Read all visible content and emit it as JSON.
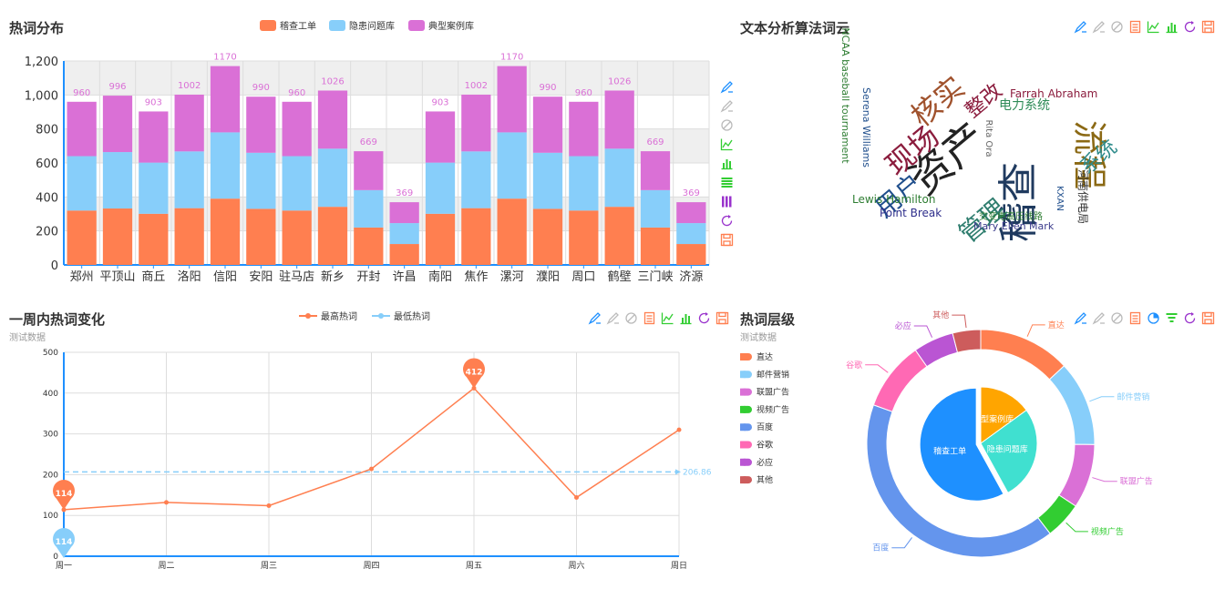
{
  "hot_distribution": {
    "title": "热词分布"
  },
  "word_cloud_panel": {
    "title": "文本分析算法词云"
  },
  "week_panel": {
    "title": "一周内热词变化",
    "subtitle": "测试数据"
  },
  "level_panel": {
    "title": "热词层级",
    "subtitle": "测试数据"
  },
  "colors": {
    "orange": "#ff7f50",
    "skyblue": "#87cefa",
    "orchid": "#da70d6",
    "green": "#32cd32",
    "cornflower": "#6495ed",
    "hotpink": "#ff69b4",
    "purple": "#ba55d3",
    "indianred": "#cd5c5c",
    "dodgerblue": "#1e90ff",
    "turquoise": "#40e0d0",
    "gold": "#ffa500",
    "toolbox": "#1e90ff"
  },
  "toolbox_icons": [
    "mark-icon",
    "mark-undo-icon",
    "mark-clear-icon",
    "data-view-icon",
    "line-chart-icon",
    "bar-chart-icon",
    "restore-icon",
    "save-image-icon"
  ],
  "chart_data": [
    {
      "type": "bar",
      "stacked": true,
      "categories": [
        "郑州",
        "平顶山",
        "商丘",
        "洛阳",
        "信阳",
        "安阳",
        "驻马店",
        "新乡",
        "开封",
        "许昌",
        "南阳",
        "焦作",
        "漯河",
        "濮阳",
        "周口",
        "鹤壁",
        "三门峡",
        "济源"
      ],
      "series": [
        {
          "name": "稽查工单",
          "color": "#ff7f50",
          "values": [
            320,
            332,
            301,
            334,
            390,
            330,
            320,
            342,
            220,
            123,
            301,
            334,
            390,
            330,
            320,
            342,
            220,
            123
          ]
        },
        {
          "name": "隐患问题库",
          "color": "#87cefa",
          "values": [
            320,
            332,
            301,
            334,
            390,
            330,
            320,
            342,
            220,
            123,
            301,
            334,
            390,
            330,
            320,
            342,
            220,
            123
          ]
        },
        {
          "name": "典型案例库",
          "color": "#da70d6",
          "values": [
            320,
            332,
            301,
            334,
            390,
            330,
            320,
            342,
            229,
            123,
            301,
            334,
            390,
            330,
            320,
            342,
            229,
            123
          ]
        }
      ],
      "totals": [
        960,
        996,
        903,
        1002,
        1170,
        990,
        960,
        1026,
        669,
        369,
        903,
        1002,
        1170,
        990,
        960,
        1026,
        669,
        369
      ],
      "yticks": [
        "0",
        "200",
        "400",
        "600",
        "800",
        "1,000",
        "1,200"
      ],
      "ylim": [
        0,
        1200
      ],
      "legend_position": "top-center"
    },
    {
      "type": "wordcloud",
      "words": [
        {
          "text": "资产",
          "color": "#222222"
        },
        {
          "text": "稽查",
          "color": "#1f3a5f"
        },
        {
          "text": "流程",
          "color": "#8b6914"
        },
        {
          "text": "现场",
          "color": "#8b1c3d"
        },
        {
          "text": "核实",
          "color": "#a0522d"
        },
        {
          "text": "用户",
          "color": "#1f4e8c"
        },
        {
          "text": "管理",
          "color": "#2e7d6e"
        },
        {
          "text": "整改",
          "color": "#8b1c3d"
        },
        {
          "text": "系统",
          "color": "#2e8b8b"
        },
        {
          "text": "电力系统",
          "color": "#2e8b57"
        },
        {
          "text": "Farrah Abraham",
          "color": "#8b1c3d"
        },
        {
          "text": "河南供电局",
          "color": "#333333"
        },
        {
          "text": "KXAN",
          "color": "#1f4e8c"
        },
        {
          "text": "交变电高压线路",
          "color": "#2e7d32"
        },
        {
          "text": "Mary Ellen Mark",
          "color": "#3a3a8b"
        },
        {
          "text": "Point Break",
          "color": "#2e2e8b"
        },
        {
          "text": "Lewis Hamilton",
          "color": "#2e7d32"
        },
        {
          "text": "Serena Williams",
          "color": "#1f4e8c"
        },
        {
          "text": "NCAA baseball tournament",
          "color": "#2e7d32"
        },
        {
          "text": "Rita Ora",
          "color": "#666666"
        }
      ]
    },
    {
      "type": "line",
      "x": [
        "周一",
        "周二",
        "周三",
        "周四",
        "周五",
        "周六",
        "周日"
      ],
      "series": [
        {
          "name": "最高热词",
          "color": "#ff7f50",
          "values": [
            114,
            132,
            124,
            214,
            412,
            144,
            310
          ]
        },
        {
          "name": "最低热词",
          "color": "#87cefa",
          "values": []
        }
      ],
      "mark_points": [
        {
          "label": "412",
          "color": "#ff7f50"
        },
        {
          "label": "114",
          "color": "#ff7f50"
        },
        {
          "label": "114",
          "color": "#87cefa"
        }
      ],
      "mark_line": {
        "label": "206.86",
        "value": 206.86,
        "color": "#87cefa"
      },
      "yticks": [
        "0",
        "100",
        "200",
        "300",
        "400",
        "500"
      ],
      "ylim": [
        0,
        500
      ],
      "legend_position": "top-center"
    },
    {
      "type": "pie",
      "inner": [
        {
          "name": "稽查工单",
          "value": 58,
          "color": "#1e90ff"
        },
        {
          "name": "隐患问题库",
          "value": 27,
          "color": "#40e0d0"
        },
        {
          "name": "典型案例库",
          "value": 15,
          "color": "#ffa500"
        }
      ],
      "outer": [
        {
          "name": "直达",
          "value": 335,
          "color": "#ff7f50"
        },
        {
          "name": "邮件营销",
          "value": 310,
          "color": "#87cefa"
        },
        {
          "name": "联盟广告",
          "value": 234,
          "color": "#da70d6"
        },
        {
          "name": "视频广告",
          "value": 135,
          "color": "#32cd32"
        },
        {
          "name": "百度",
          "value": 1048,
          "color": "#6495ed"
        },
        {
          "name": "谷歌",
          "value": 251,
          "color": "#ff69b4"
        },
        {
          "name": "必应",
          "value": 147,
          "color": "#ba55d3"
        },
        {
          "name": "其他",
          "value": 102,
          "color": "#cd5c5c"
        }
      ],
      "legend_position": "left"
    }
  ]
}
